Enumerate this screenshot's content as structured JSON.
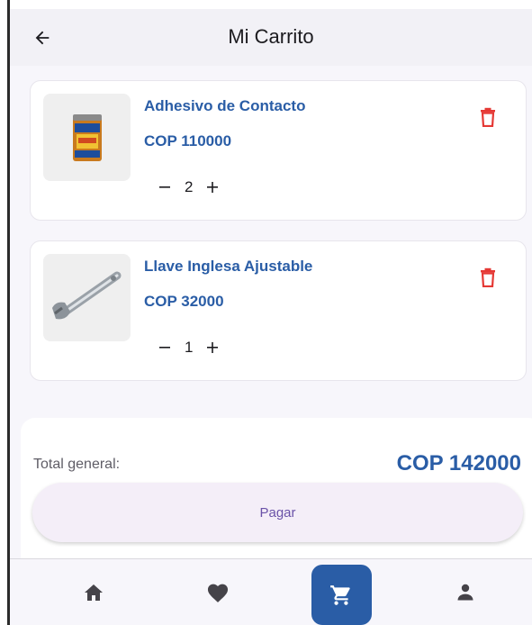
{
  "header": {
    "title": "Mi Carrito",
    "back_icon": "arrow-left-icon"
  },
  "cart": {
    "items": [
      {
        "name": "Adhesivo de Contacto",
        "price": "COP 110000",
        "quantity": "2",
        "image": "adhesive-can-image"
      },
      {
        "name": "Llave Inglesa Ajustable",
        "price": "COP 32000",
        "quantity": "1",
        "image": "adjustable-wrench-image"
      }
    ],
    "quantity_icons": {
      "decrease": "minus-icon",
      "increase": "plus-icon"
    },
    "delete_icon": "trash-icon"
  },
  "summary": {
    "total_label": "Total general:",
    "total_value": "COP 142000",
    "pay_label": "Pagar"
  },
  "nav": {
    "items": [
      {
        "icon": "home-icon",
        "active": false
      },
      {
        "icon": "heart-icon",
        "active": false
      },
      {
        "icon": "cart-icon",
        "active": true
      },
      {
        "icon": "person-icon",
        "active": false
      }
    ]
  },
  "colors": {
    "accent": "#2a5da6",
    "delete": "#e53935",
    "pay_button_bg": "#f4eef8",
    "pay_button_text": "#6a52a8",
    "background": "#f7f6fb"
  }
}
